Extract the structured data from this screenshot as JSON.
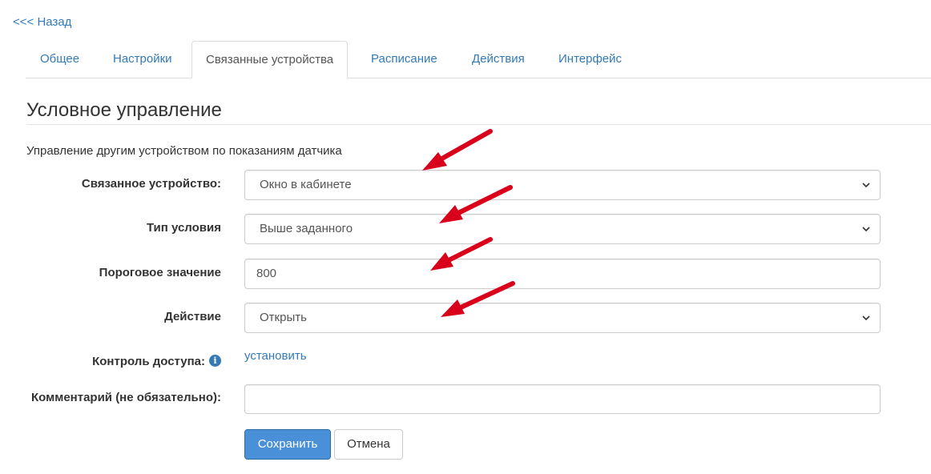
{
  "nav": {
    "back_label": "<<< Назад"
  },
  "tabs": [
    {
      "label": "Общее"
    },
    {
      "label": "Настройки"
    },
    {
      "label": "Связанные устройства",
      "active": true
    },
    {
      "label": "Расписание"
    },
    {
      "label": "Действия"
    },
    {
      "label": "Интерфейс"
    }
  ],
  "section": {
    "title": "Условное управление",
    "description": "Управление другим устройством по показаниям датчика"
  },
  "form": {
    "linked_device": {
      "label": "Связанное устройство:",
      "value": "Окно в кабинете"
    },
    "condition_type": {
      "label": "Тип условия",
      "value": "Выше заданного"
    },
    "threshold": {
      "label": "Пороговое значение",
      "value": "800"
    },
    "action": {
      "label": "Действие",
      "value": "Открыть"
    },
    "access_control": {
      "label": "Контроль доступа:",
      "info_icon": "info-icon",
      "link": "установить"
    },
    "comment": {
      "label": "Комментарий (не обязательно):",
      "value": ""
    }
  },
  "buttons": {
    "save": "Сохранить",
    "cancel": "Отмена"
  },
  "colors": {
    "link": "#337ab7",
    "primary": "#4a90d9",
    "annotation_arrow": "#d9001b"
  }
}
